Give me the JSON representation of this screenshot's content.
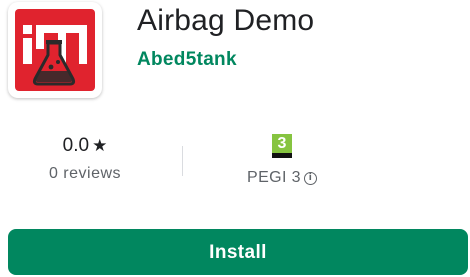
{
  "app": {
    "title": "Airbag Demo",
    "developer": "Abed5tank",
    "icon_name": "lab-flask-logo-icon"
  },
  "stats": {
    "rating_value": "0.0",
    "rating_star": "★",
    "reviews_label": "0 reviews",
    "content_rating_badge": "3",
    "content_rating_label": "PEGI 3",
    "info_icon": "i"
  },
  "actions": {
    "install_label": "Install"
  },
  "colors": {
    "accent": "#01875f",
    "icon_red": "#e0232e",
    "pegi_green": "#86c440"
  }
}
